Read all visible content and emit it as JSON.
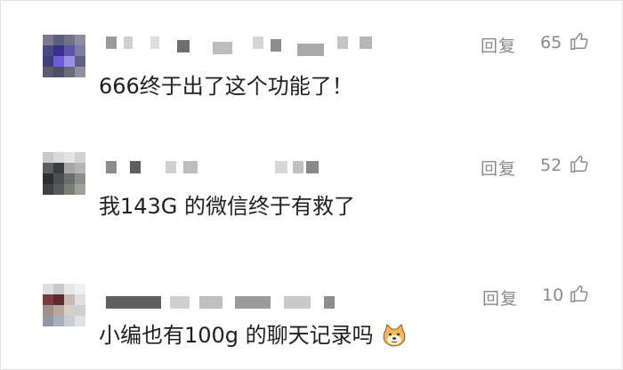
{
  "comments": [
    {
      "text": "666终于出了这个功能了！",
      "reply_label": "回复",
      "likes": "65"
    },
    {
      "text": "我143G 的微信终于有救了",
      "reply_label": "回复",
      "likes": "52"
    },
    {
      "text": "小编也有100g 的聊天记录吗",
      "reply_label": "回复",
      "likes": "10",
      "emoji_icon": "doge-emoji-icon"
    }
  ],
  "icons": {
    "like": "thumbs-up-icon",
    "avatar": "pixelated-avatar"
  },
  "colors": {
    "meta_text": "#8a8a8a",
    "comment_text": "#1f1f1f",
    "border": "#e2e2e2"
  }
}
